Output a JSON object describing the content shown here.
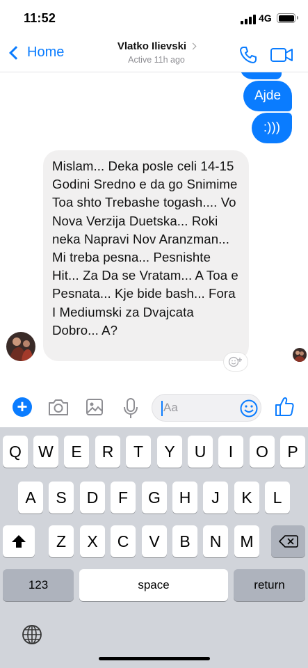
{
  "status": {
    "time": "11:52",
    "network": "4G"
  },
  "header": {
    "back_label": "Home",
    "contact_name": "Vlatko Ilievski",
    "active_status": "Active 11h ago",
    "icons": [
      "back-chevron-icon",
      "phone-icon",
      "video-icon"
    ]
  },
  "messages": {
    "sent_1": "Ajde",
    "sent_2": ":)))",
    "received": "Mislam... Deka posle celi 14-15 Godini Sredno e da go Snimime Toa shto Trebashe togash.... Vo Nova Verzija Duetska... Roki neka Napravi Nov Aranzman... Mi treba pesna... Pesnishte Hit... Za Da se Vratam... A Toa e Pesnata... Kje bide bash... Fora I Mediumski za Dvajcata Dobro... A?"
  },
  "composer": {
    "placeholder": "Aa",
    "icons": [
      "plus-icon",
      "camera-icon",
      "image-icon",
      "microphone-icon",
      "emoji-icon",
      "thumbs-up-icon"
    ]
  },
  "keyboard": {
    "row1": [
      "Q",
      "W",
      "E",
      "R",
      "T",
      "Y",
      "U",
      "I",
      "O",
      "P"
    ],
    "row2": [
      "A",
      "S",
      "D",
      "F",
      "G",
      "H",
      "J",
      "K",
      "L"
    ],
    "row3": [
      "Z",
      "X",
      "C",
      "V",
      "B",
      "N",
      "M"
    ],
    "numbers_label": "123",
    "space_label": "space",
    "return_label": "return"
  },
  "colors": {
    "accent": "#0a7cff",
    "bubble_in": "#f1f0f0",
    "keyboard_bg": "#d1d4da"
  }
}
